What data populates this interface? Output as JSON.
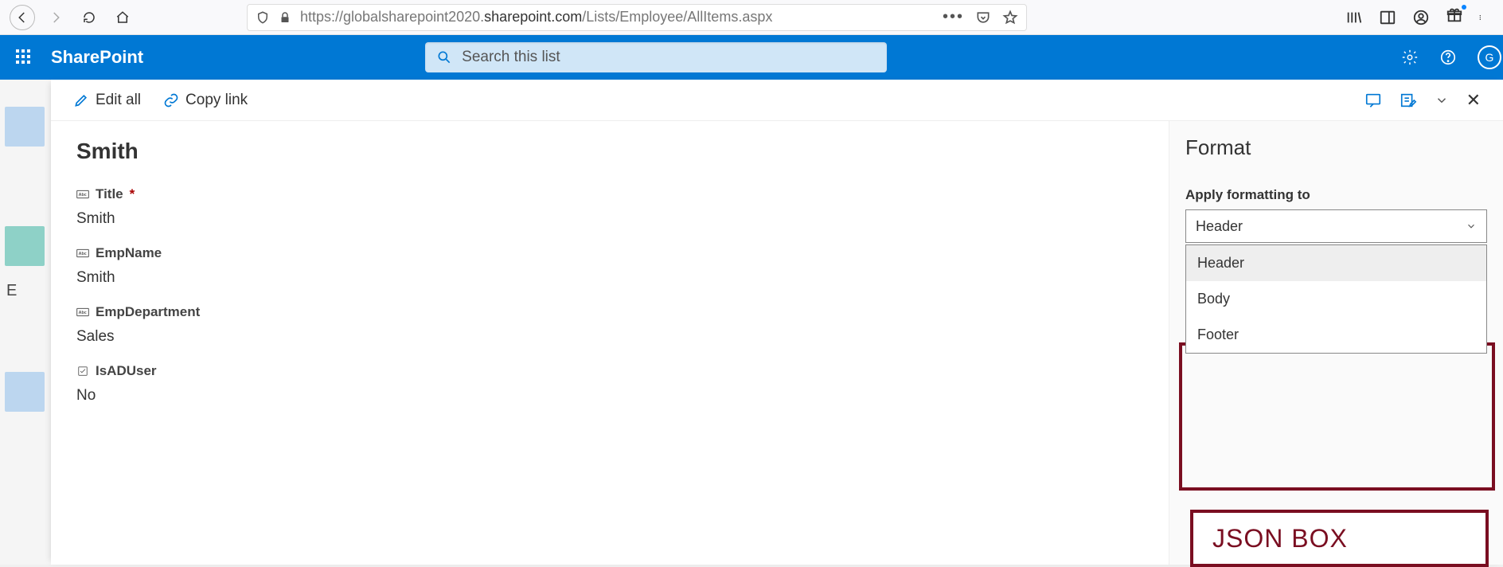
{
  "browser": {
    "url_prefix": "https://globalsharepoint2020.",
    "url_bold": "sharepoint.com",
    "url_suffix": "/Lists/Employee/AllItems.aspx"
  },
  "suite": {
    "brand": "SharePoint",
    "search_placeholder": "Search this list",
    "avatar_initials": "G"
  },
  "left_rail": {
    "label": "E"
  },
  "toolbar": {
    "edit_all": "Edit all",
    "copy_link": "Copy link"
  },
  "details": {
    "heading": "Smith",
    "fields": {
      "title_label": "Title",
      "title_value": "Smith",
      "empname_label": "EmpName",
      "empname_value": "Smith",
      "empdept_label": "EmpDepartment",
      "empdept_value": "Sales",
      "isad_label": "IsADUser",
      "isad_value": "No"
    }
  },
  "format": {
    "heading": "Format",
    "apply_label": "Apply formatting to",
    "selected": "Header",
    "options": {
      "header": "Header",
      "body": "Body",
      "footer": "Footer"
    },
    "json_box": "JSON BOX"
  }
}
